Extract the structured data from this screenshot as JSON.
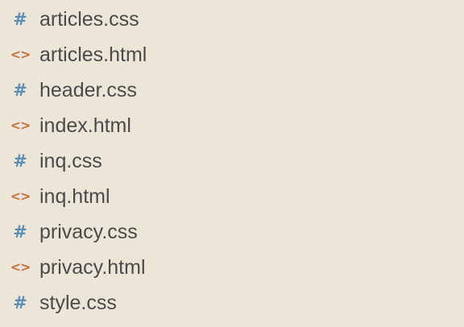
{
  "colors": {
    "background": "#ece6d8",
    "css_icon": "#5b8fb9",
    "html_icon": "#c7733b",
    "text": "#4a4a4a"
  },
  "icons": {
    "css": {
      "name": "hash-icon",
      "glyph": "#"
    },
    "html": {
      "name": "code-brackets-icon",
      "glyph": "<>"
    }
  },
  "files": [
    {
      "name": "articles.css",
      "type": "css"
    },
    {
      "name": "articles.html",
      "type": "html"
    },
    {
      "name": "header.css",
      "type": "css"
    },
    {
      "name": "index.html",
      "type": "html"
    },
    {
      "name": "inq.css",
      "type": "css"
    },
    {
      "name": "inq.html",
      "type": "html"
    },
    {
      "name": "privacy.css",
      "type": "css"
    },
    {
      "name": "privacy.html",
      "type": "html"
    },
    {
      "name": "style.css",
      "type": "css"
    }
  ]
}
